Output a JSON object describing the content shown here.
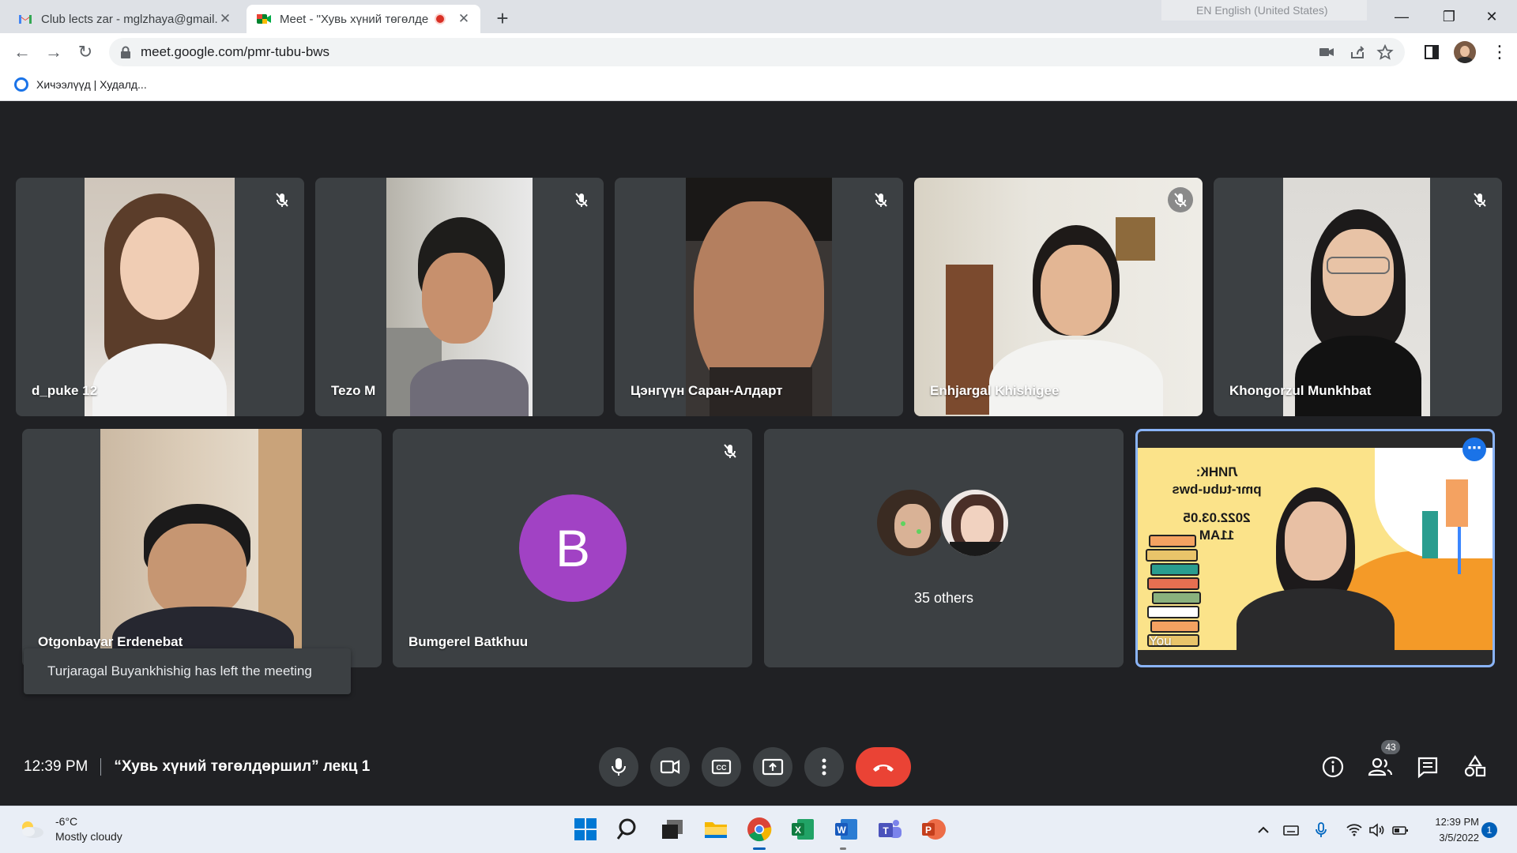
{
  "browser": {
    "tabs": [
      {
        "title": "Club lects zar - mglzhaya@gmail.",
        "close": "✕"
      },
      {
        "title": "Meet - \"Хувь хүний төгөлде",
        "close": "✕"
      }
    ],
    "new_tab": "+",
    "language_indicator": "EN English (United States)",
    "url": "meet.google.com/pmr-tubu-bws",
    "bookmark": "Хичээлүүд | Худалд..."
  },
  "tiles": [
    {
      "name": "d_puke 12"
    },
    {
      "name": "Tezo M"
    },
    {
      "name": "Цэнгүүн Саран-Алдарт"
    },
    {
      "name": "Enhjargal Khishigee"
    },
    {
      "name": "Khongorzul Munkhbat"
    },
    {
      "name": "Otgonbayar Erdenebat"
    },
    {
      "name": "Bumgerel Batkhuu",
      "initial": "B"
    },
    {
      "others_label": "35 others"
    },
    {
      "name": "You"
    }
  ],
  "presentation": {
    "link_label": "ЛИНК:",
    "link": "pmr-tubu-bws",
    "date": "2022.03.05",
    "time": "11AM"
  },
  "toast": "Turjaragal Buyankhishig has left the meeting",
  "meeting": {
    "time": "12:39 PM",
    "title": "“Хувь хүний төгөлдөршил” лекц 1",
    "participants_count": "43"
  },
  "taskbar": {
    "temperature": "-6°C",
    "weather": "Mostly cloudy",
    "clock_time": "12:39 PM",
    "clock_date": "3/5/2022",
    "notifications": "1"
  },
  "colors": {
    "accent": "#1a73e8",
    "end_call": "#ea4335",
    "avatar_b": "#a142c4",
    "meet_bg": "#202124",
    "tile_bg": "#3c4043"
  }
}
